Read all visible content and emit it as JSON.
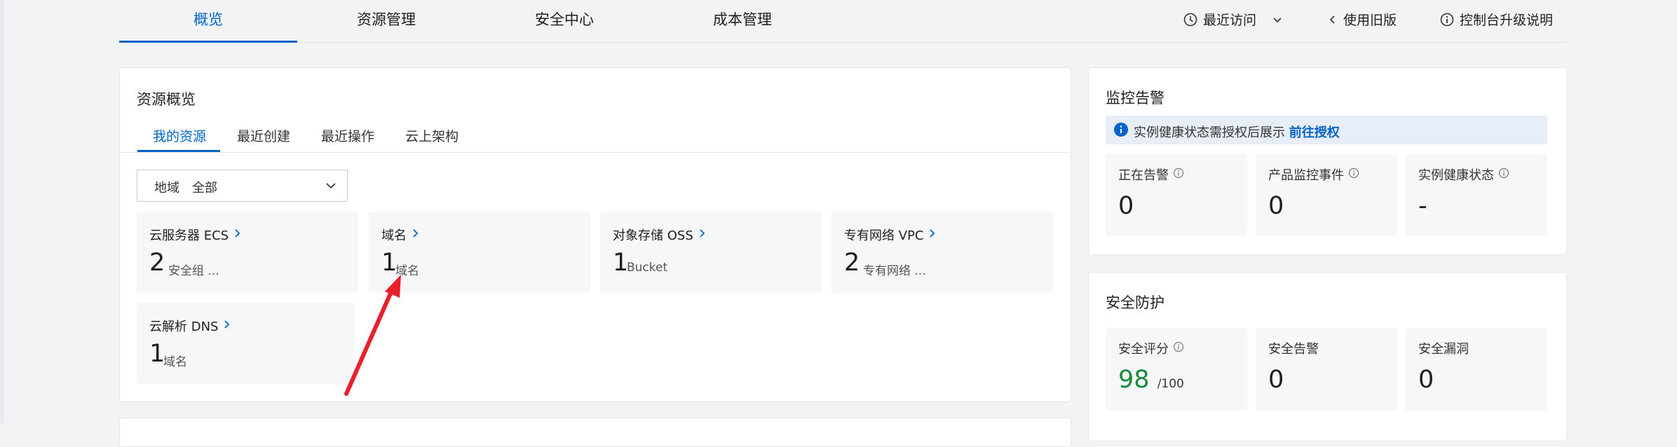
{
  "topnav": {
    "tabs": [
      {
        "label": "概览",
        "active": true
      },
      {
        "label": "资源管理",
        "active": false
      },
      {
        "label": "安全中心",
        "active": false
      },
      {
        "label": "成本管理",
        "active": false
      }
    ],
    "recent_visits": "最近访问",
    "old_version": "使用旧版",
    "upgrade_info": "控制台升级说明"
  },
  "overview": {
    "title": "资源概览",
    "tabs": [
      "我的资源",
      "最近创建",
      "最近操作",
      "云上架构"
    ],
    "region": {
      "label": "地域",
      "value": "全部"
    },
    "tiles": [
      {
        "name": "云服务器 ECS",
        "count": "2",
        "sub": "安全组 ..."
      },
      {
        "name": "域名",
        "count": "1",
        "sub": "域名"
      },
      {
        "name": "对象存储 OSS",
        "count": "1",
        "sub": "Bucket"
      },
      {
        "name": "专有网络 VPC",
        "count": "2",
        "sub": "专有网络 ..."
      },
      {
        "name": "云解析 DNS",
        "count": "1",
        "sub": "域名"
      }
    ]
  },
  "monitor": {
    "title": "监控告警",
    "info_text": "实例健康状态需授权后展示",
    "info_link": "前往授权",
    "stats": [
      {
        "label": "正在告警",
        "value": "0"
      },
      {
        "label": "产品监控事件",
        "value": "0"
      },
      {
        "label": "实例健康状态",
        "value": "-"
      }
    ]
  },
  "security": {
    "title": "安全防护",
    "score_label": "安全评分",
    "score_value": "98",
    "score_suffix": "/100",
    "alerts_label": "安全告警",
    "alerts_value": "0",
    "vuln_label": "安全漏洞",
    "vuln_value": "0"
  },
  "colors": {
    "accent": "#0064c8",
    "score": "#1a8a3a",
    "arrow": "#e8202a"
  }
}
